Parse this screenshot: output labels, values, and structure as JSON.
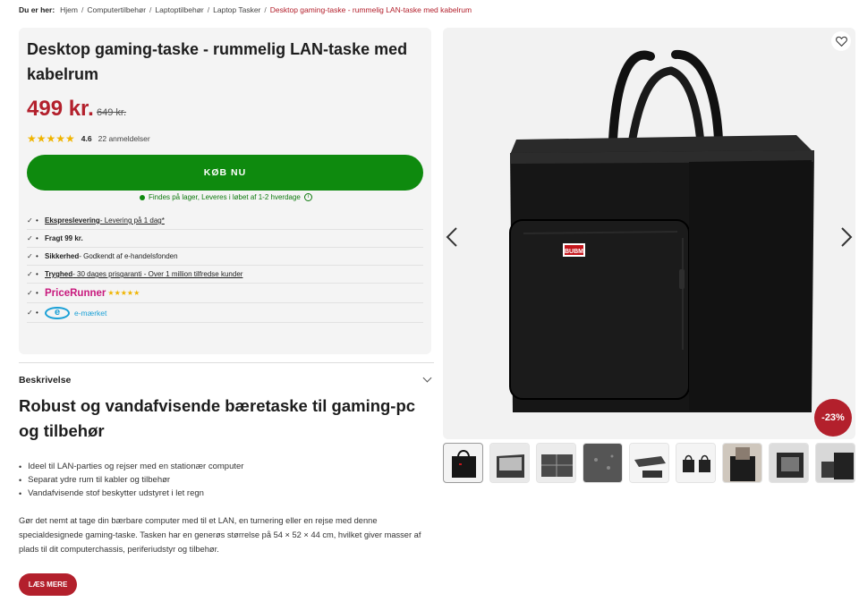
{
  "breadcrumb": {
    "lead": "Du er her:",
    "items": [
      "Hjem",
      "Computertilbehør",
      "Laptoptilbehør",
      "Laptop Tasker"
    ],
    "current": "Desktop gaming-taske - rummelig LAN-taske med kabelrum"
  },
  "product": {
    "title": "Desktop gaming-taske - rummelig LAN-taske med kabelrum",
    "price": "499 kr.",
    "old_price": "649 kr.",
    "stars": "★★★★★",
    "rating": "4.6",
    "reviews": "22 anmeldelser",
    "buy_label": "KØB NU",
    "stock_text": "Findes på lager, Leveres i løbet af 1-2 hverdage",
    "discount": "-23%"
  },
  "usps": [
    {
      "check": "✓",
      "bold": "Ekspreslevering",
      "text": " - Levering på 1 dag*"
    },
    {
      "check": "✓",
      "bold": "Fragt 99 kr.",
      "text": ""
    },
    {
      "check": "✓",
      "bold": "Sikkerhed",
      "text": " - Godkendt af e-handelsfonden"
    },
    {
      "check": "✓",
      "bold": "Tryghed",
      "text": " - 30 dages prisgaranti - Over 1 million tilfredse kunder"
    }
  ],
  "badges": {
    "pricerunner": "PriceRunner",
    "pricerunner_stars": "★★★★★",
    "emark_letter": "e",
    "emark": "e-mærket"
  },
  "description": {
    "header": "Beskrivelse",
    "title": "Robust og vandafvisende bæretaske til gaming-pc og tilbehør",
    "bullets": [
      "Ideel til LAN-parties og rejser med en stationær computer",
      "Separat ydre rum til kabler og tilbehør",
      "Vandafvisende stof beskytter udstyret i let regn"
    ],
    "paragraph": "Gør det nemt at tage din bærbare computer med til et LAN, en turnering eller en rejse med denne specialdesignede gaming-taske. Tasken har en generøs størrelse på 54 × 52 × 44 cm, hvilket giver masser af plads til dit computerchassis, periferiudstyr og tilbehør.",
    "read_more": "LÆS MERE"
  },
  "bag_logo": "BUBM",
  "colors": {
    "brand_red": "#b3202c",
    "buy_green": "#0e8a0e",
    "star": "#f0b400",
    "pricerunner": "#c8197d",
    "emark": "#1aa0d6"
  }
}
